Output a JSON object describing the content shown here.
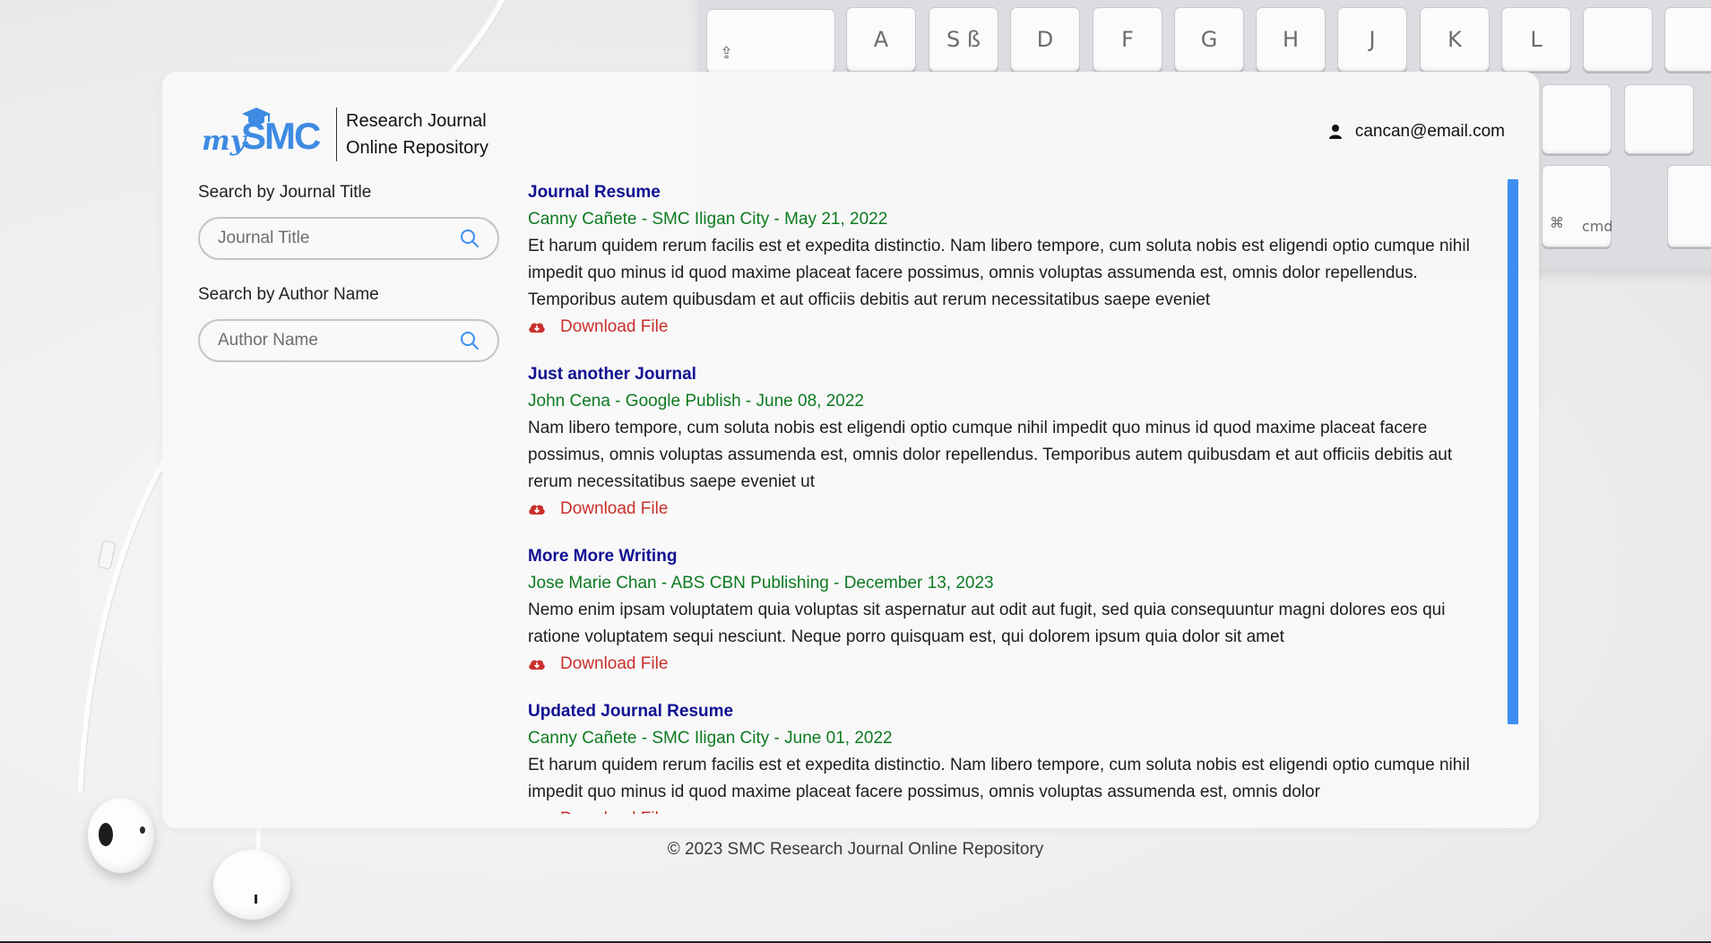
{
  "logo": {
    "my": "my",
    "smc": "SMC",
    "line1": "Research Journal",
    "line2": "Online Repository"
  },
  "user": {
    "icon": "person-icon",
    "email": "cancan@email.com"
  },
  "sidebar": {
    "title_search": {
      "label": "Search by Journal Title",
      "placeholder": "Journal Title",
      "icon": "search-icon"
    },
    "author_search": {
      "label": "Search by Author Name",
      "placeholder": "Author Name",
      "icon": "search-icon"
    }
  },
  "journals": [
    {
      "title": "Journal Resume",
      "meta": "Canny Cañete - SMC Iligan City - May 21, 2022",
      "abstract": "Et harum quidem rerum facilis est et expedita distinctio. Nam libero tempore, cum soluta nobis est eligendi optio cumque nihil impedit quo minus id quod maxime placeat facere possimus, omnis voluptas assumenda est, omnis dolor repellendus. Temporibus autem quibusdam et aut officiis debitis aut rerum necessitatibus saepe eveniet",
      "download": "Download File"
    },
    {
      "title": "Just another Journal",
      "meta": "John Cena - Google Publish - June 08, 2022",
      "abstract": "Nam libero tempore, cum soluta nobis est eligendi optio cumque nihil impedit quo minus id quod maxime placeat facere possimus, omnis voluptas assumenda est, omnis dolor repellendus. Temporibus autem quibusdam et aut officiis debitis aut rerum necessitatibus saepe eveniet ut",
      "download": "Download File"
    },
    {
      "title": "More More Writing",
      "meta": "Jose Marie Chan - ABS CBN Publishing - December 13, 2023",
      "abstract": "Nemo enim ipsam voluptatem quia voluptas sit aspernatur aut odit aut fugit, sed quia consequuntur magni dolores eos qui ratione voluptatem sequi nesciunt. Neque porro quisquam est, qui dolorem ipsum quia dolor sit amet",
      "download": "Download File"
    },
    {
      "title": "Updated Journal Resume",
      "meta": "Canny Cañete - SMC Iligan City - June 01, 2022",
      "abstract": "Et harum quidem rerum facilis est et expedita distinctio. Nam libero tempore, cum soluta nobis est eligendi optio cumque nihil impedit quo minus id quod maxime placeat facere possimus, omnis voluptas assumenda est, omnis dolor",
      "download": "Download File"
    }
  ],
  "footer": "© 2023 SMC Research Journal Online Repository",
  "background": {
    "keys_row1": [
      "A",
      "S ß",
      "D",
      "F",
      "G",
      "H",
      "J",
      "K",
      "L"
    ],
    "key_cmd": "cmd",
    "key_cmd_symbol": "⌘"
  },
  "colors": {
    "title": "#101092",
    "meta": "#0d7a20",
    "download": "#c9302c",
    "brand": "#3e8be3",
    "scrollbar": "#3d8ef0"
  }
}
